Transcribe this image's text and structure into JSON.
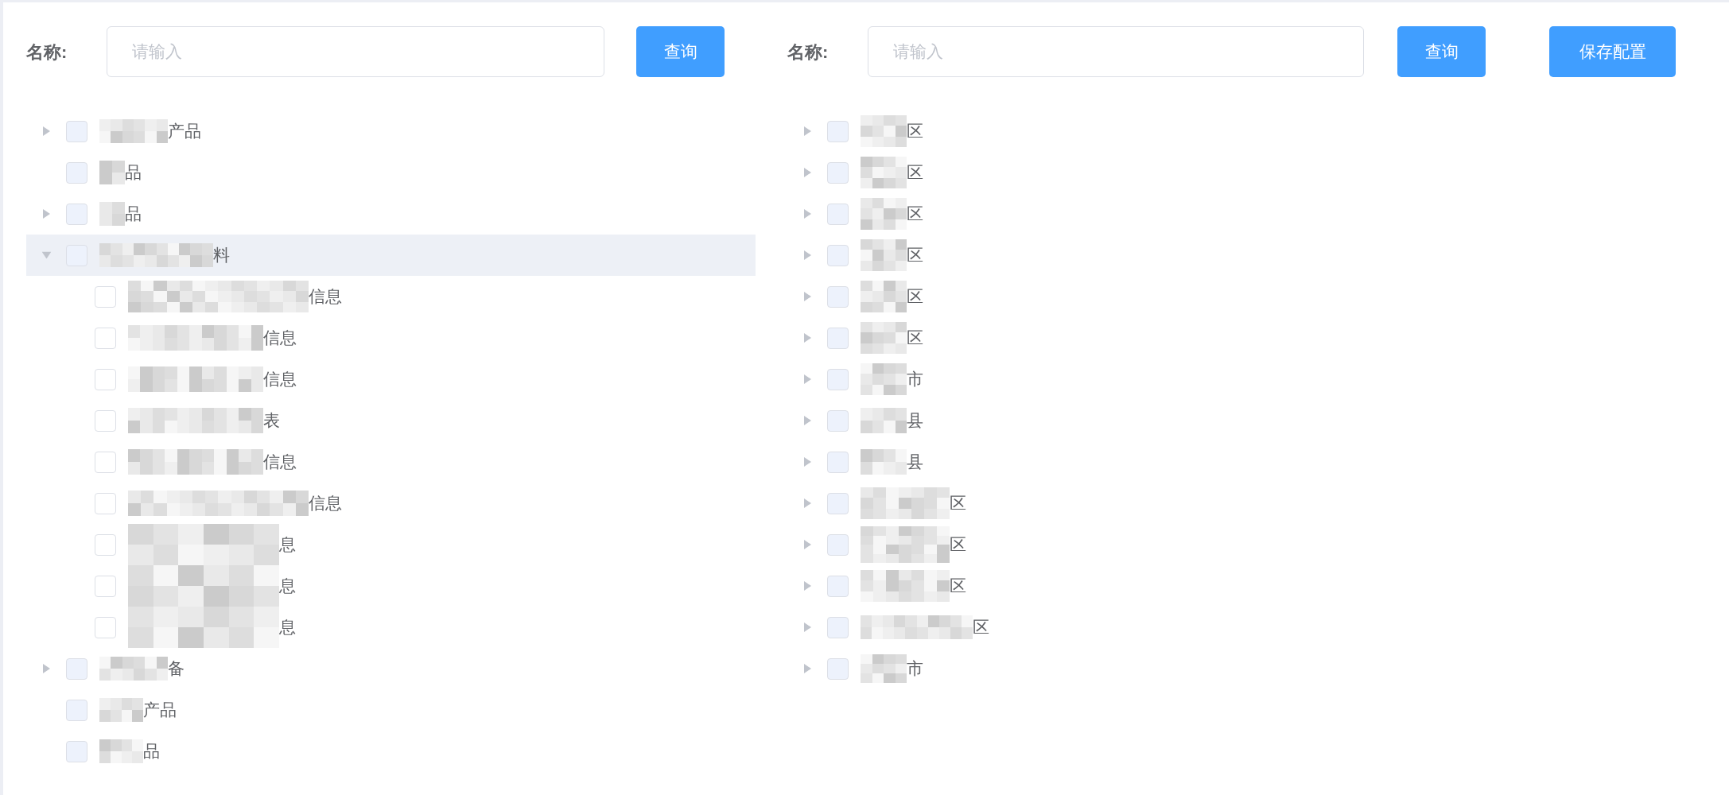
{
  "left_panel": {
    "search": {
      "label": "名称:",
      "placeholder": "请输入",
      "button": "查询"
    },
    "tree": [
      {
        "label": "产品",
        "expanded": false,
        "selected": false,
        "checked": false,
        "disabled": true,
        "redacted": true
      },
      {
        "label": "品",
        "selected": false,
        "checked": false,
        "disabled": true,
        "redacted": true
      },
      {
        "label": "品",
        "expanded": false,
        "selected": false,
        "checked": false,
        "disabled": true,
        "redacted": true
      },
      {
        "label": "料",
        "expanded": true,
        "selected": true,
        "checked": false,
        "disabled": true,
        "redacted": true,
        "children": [
          {
            "label": "信息",
            "selected": false,
            "checked": false,
            "disabled": false,
            "redacted": true
          },
          {
            "label": "信息",
            "selected": false,
            "checked": false,
            "disabled": false,
            "redacted": true
          },
          {
            "label": "信息",
            "selected": false,
            "checked": false,
            "disabled": false,
            "redacted": true
          },
          {
            "label": "表",
            "selected": false,
            "checked": false,
            "disabled": false,
            "redacted": true
          },
          {
            "label": "信息",
            "selected": false,
            "checked": false,
            "disabled": false,
            "redacted": true
          },
          {
            "label": "信息",
            "selected": false,
            "checked": false,
            "disabled": false,
            "redacted": true
          },
          {
            "label": "息",
            "selected": false,
            "checked": false,
            "disabled": false,
            "redacted": true
          },
          {
            "label": "息",
            "selected": false,
            "checked": false,
            "disabled": false,
            "redacted": true
          },
          {
            "label": "息",
            "selected": false,
            "checked": false,
            "disabled": false,
            "redacted": true
          }
        ]
      },
      {
        "label": "备",
        "expanded": false,
        "selected": false,
        "checked": false,
        "disabled": true,
        "redacted": true
      },
      {
        "label": "产品",
        "selected": false,
        "checked": false,
        "disabled": true,
        "redacted": true
      },
      {
        "label": "品",
        "selected": false,
        "checked": false,
        "disabled": true,
        "redacted": true
      }
    ]
  },
  "right_panel": {
    "search": {
      "label": "名称:",
      "placeholder": "请输入",
      "button": "查询"
    },
    "save_button": "保存配置",
    "tree": [
      {
        "label": "区",
        "expanded": false,
        "selected": false,
        "checked": false,
        "disabled": true,
        "redacted": true
      },
      {
        "label": "区",
        "expanded": false,
        "selected": false,
        "checked": false,
        "disabled": true,
        "redacted": true
      },
      {
        "label": "区",
        "expanded": false,
        "selected": false,
        "checked": false,
        "disabled": true,
        "redacted": true
      },
      {
        "label": "区",
        "expanded": false,
        "selected": false,
        "checked": false,
        "disabled": true,
        "redacted": true
      },
      {
        "label": "区",
        "expanded": false,
        "selected": false,
        "checked": false,
        "disabled": true,
        "redacted": true
      },
      {
        "label": "区",
        "expanded": false,
        "selected": false,
        "checked": false,
        "disabled": true,
        "redacted": true
      },
      {
        "label": "市",
        "expanded": false,
        "selected": false,
        "checked": false,
        "disabled": true,
        "redacted": true
      },
      {
        "label": "县",
        "expanded": false,
        "selected": false,
        "checked": false,
        "disabled": true,
        "redacted": true
      },
      {
        "label": "县",
        "expanded": false,
        "selected": false,
        "checked": false,
        "disabled": true,
        "redacted": true
      },
      {
        "label": "区",
        "expanded": false,
        "selected": false,
        "checked": false,
        "disabled": true,
        "redacted": true
      },
      {
        "label": "区",
        "expanded": false,
        "selected": false,
        "checked": false,
        "disabled": true,
        "redacted": true
      },
      {
        "label": "区",
        "expanded": false,
        "selected": false,
        "checked": false,
        "disabled": true,
        "redacted": true
      },
      {
        "label": "区",
        "expanded": false,
        "selected": false,
        "checked": false,
        "disabled": true,
        "redacted": true
      },
      {
        "label": "市",
        "expanded": false,
        "selected": false,
        "checked": false,
        "disabled": true,
        "redacted": true
      }
    ]
  }
}
